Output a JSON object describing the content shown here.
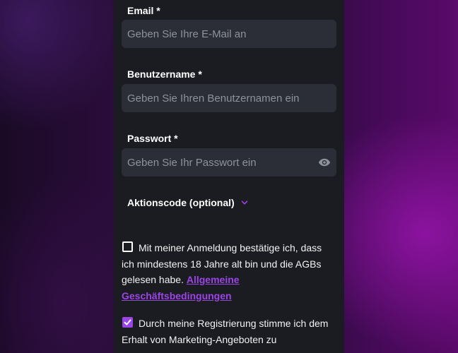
{
  "form": {
    "email": {
      "label": "Email *",
      "placeholder": "Geben Sie Ihre E-Mail an",
      "value": ""
    },
    "username": {
      "label": "Benutzername *",
      "placeholder": "Geben Sie Ihren Benutzernamen ein",
      "value": ""
    },
    "password": {
      "label": "Passwort *",
      "placeholder": "Geben Sie Ihr Passwort ein",
      "value": "",
      "toggle_icon": "eye-icon"
    },
    "promo": {
      "label": "Aktionscode (optional)",
      "icon": "chevron-down-icon"
    },
    "age_terms": {
      "checked": false,
      "text": "Mit meiner Anmeldung bestätige ich, dass ich mindestens 18 Jahre alt bin und die AGBs gelesen habe.",
      "link_text": "Allgemeine Geschäftsbedingungen"
    },
    "marketing": {
      "checked": true,
      "text": "Durch meine Registrierung stimme ich dem Erhalt von Marketing-Angeboten zu"
    }
  },
  "colors": {
    "accent": "#9b45e6",
    "panel_bg": "#1b1c22",
    "field_bg": "#2b2e37"
  }
}
